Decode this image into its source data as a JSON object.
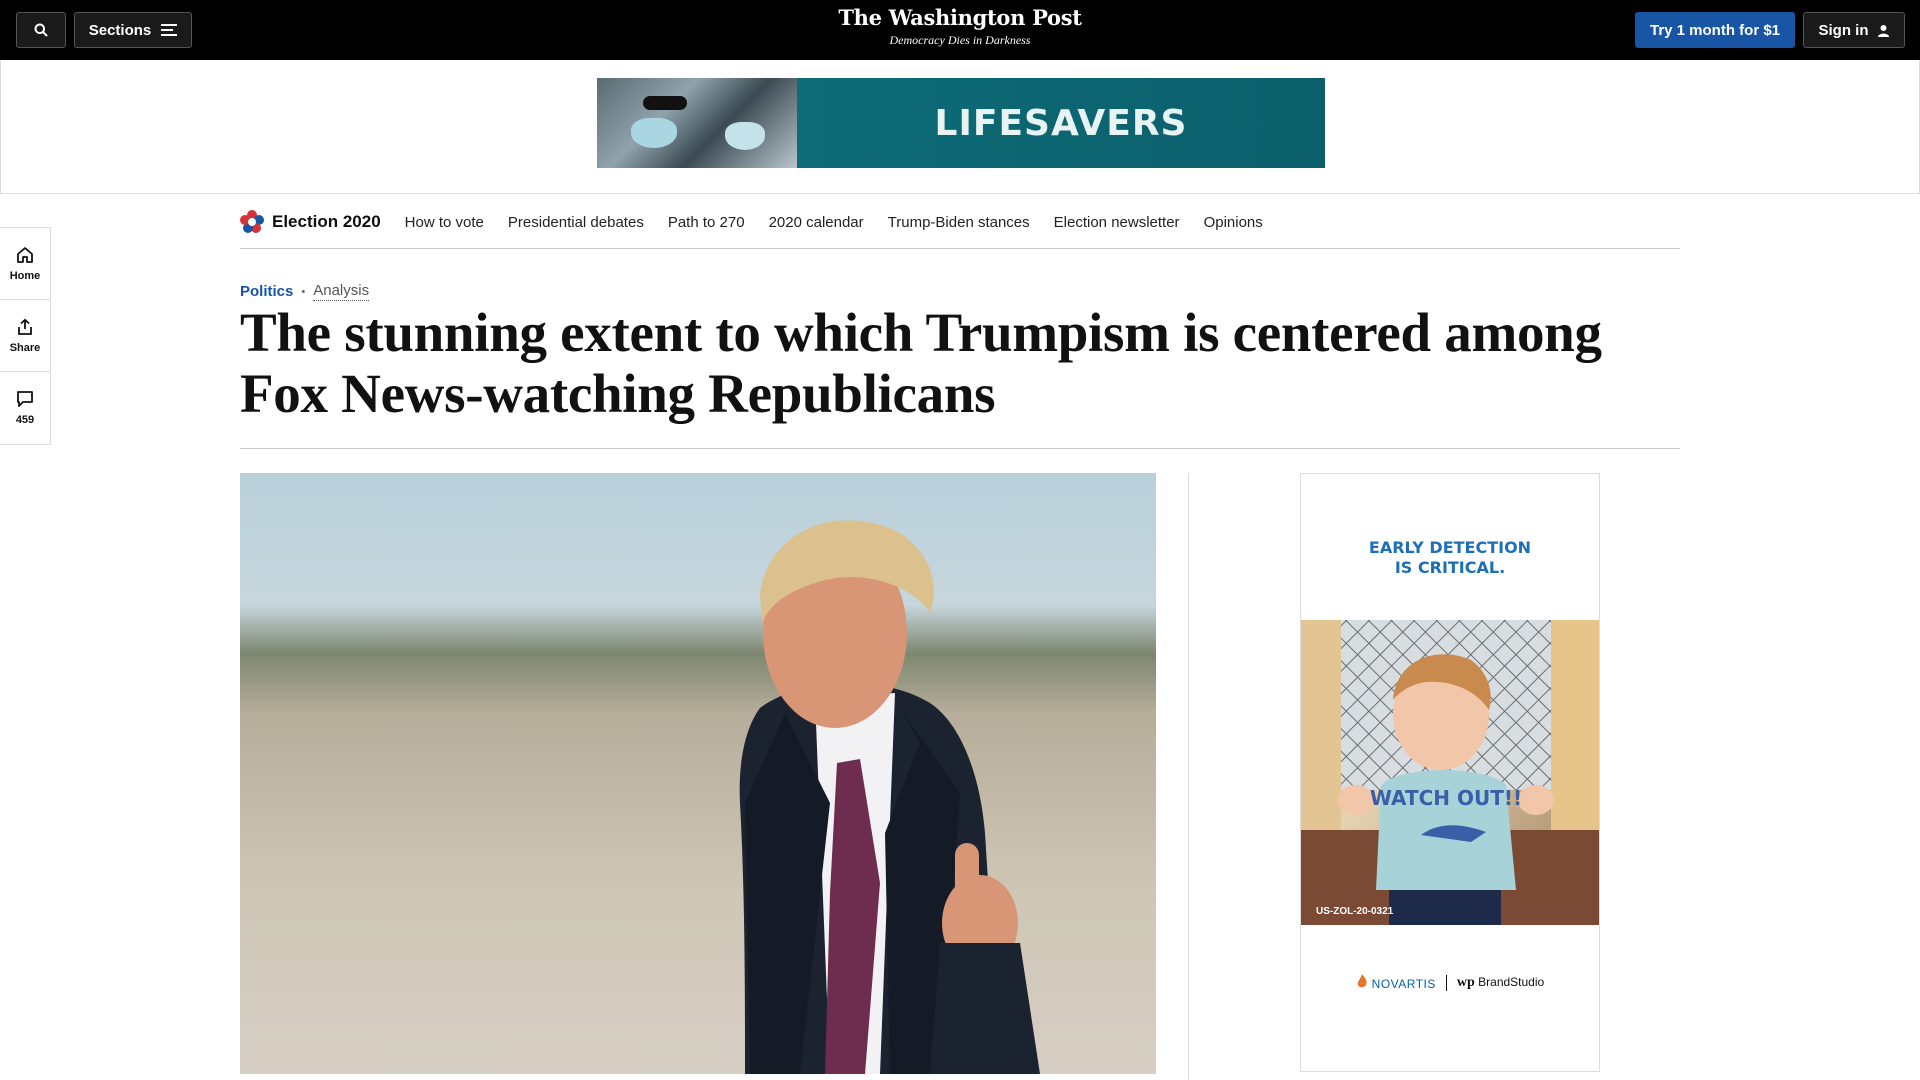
{
  "masthead": {
    "sections_label": "Sections",
    "logo_name": "The Washington Post",
    "tagline": "Democracy Dies in Darkness",
    "trial_label": "Try 1 month for $1",
    "signin_label": "Sign in"
  },
  "top_ad": {
    "text": "LIFESAVERS"
  },
  "rail": [
    {
      "label": "Home",
      "icon": "home-icon"
    },
    {
      "label": "Share",
      "icon": "share-icon"
    },
    {
      "label": "459",
      "icon": "comment-icon"
    }
  ],
  "section_nav": {
    "brand": "Election 2020",
    "links": [
      "How to vote",
      "Presidential debates",
      "Path to 270",
      "2020 calendar",
      "Trump-Biden stances",
      "Election newsletter",
      "Opinions"
    ]
  },
  "article": {
    "section": "Politics",
    "label": "Analysis",
    "headline": "The stunning extent to which Trumpism is centered among Fox News-watching Republicans"
  },
  "side_ad": {
    "headline": "EARLY DETECTION IS CRITICAL.",
    "shirt_text": "WATCH OUT!!",
    "code": "US-ZOL-20-0321",
    "sponsor": "NOVARTIS",
    "studio_mark": "wp",
    "studio": "BrandStudio"
  },
  "colors": {
    "masthead_bg": "#000000",
    "accent_blue": "#1955a5",
    "ad_teal": "#0d6c78"
  }
}
